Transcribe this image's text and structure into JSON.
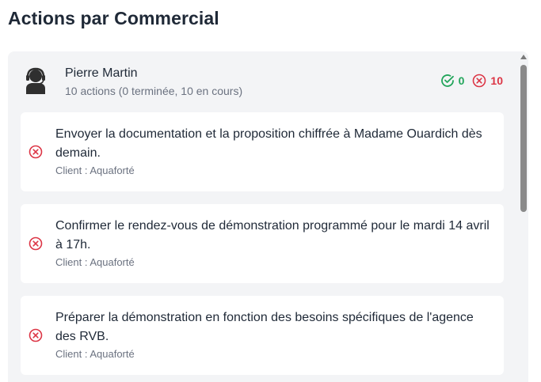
{
  "title": "Actions par Commercial",
  "commercial": {
    "name": "Pierre Martin",
    "summary": "10 actions (0 terminée, 10 en cours)",
    "done_count": "0",
    "open_count": "10"
  },
  "actions": [
    {
      "text": "Envoyer la documentation et la proposition chiffrée à Madame Ouardich dès demain.",
      "client": "Client : Aquaforté"
    },
    {
      "text": "Confirmer le rendez-vous de démonstration programmé pour le mardi 14 avril à 17h.",
      "client": "Client : Aquaforté"
    },
    {
      "text": "Préparer la démonstration en fonction des besoins spécifiques de l'agence des RVB.",
      "client": "Client : Aquaforté"
    }
  ],
  "colors": {
    "done": "#22a55b",
    "open": "#dc3545"
  },
  "icons": {
    "avatar": "support-agent-icon",
    "done": "check-circle-icon",
    "open": "x-circle-icon"
  }
}
